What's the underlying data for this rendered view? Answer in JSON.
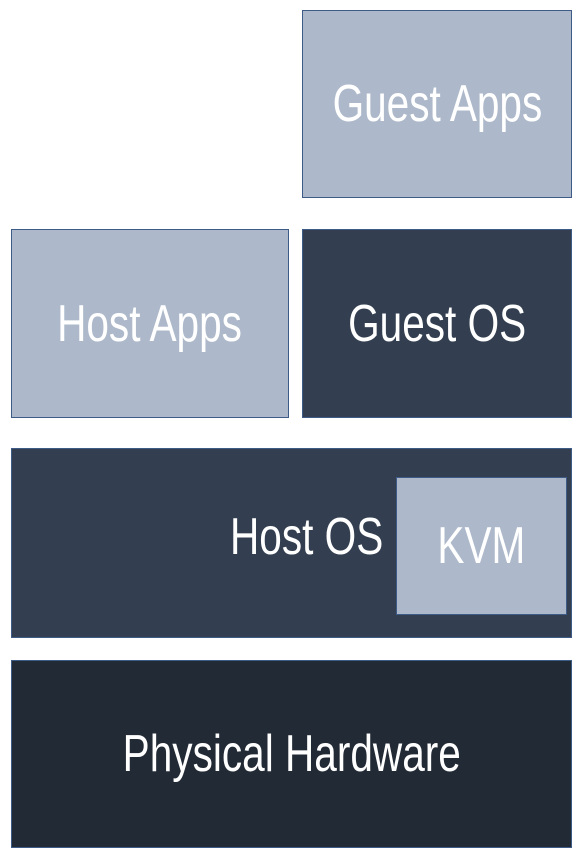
{
  "layers": {
    "guest_apps": {
      "label": "Guest Apps",
      "color": "#adb9ca"
    },
    "host_apps": {
      "label": "Host Apps",
      "color": "#adb9ca"
    },
    "guest_os": {
      "label": "Guest OS",
      "color": "#333f50"
    },
    "host_os": {
      "label": "Host OS",
      "color": "#333f50"
    },
    "kvm": {
      "label": "KVM",
      "color": "#adb9ca"
    },
    "physical_hardware": {
      "label": "Physical Hardware",
      "color": "#222a35"
    }
  }
}
